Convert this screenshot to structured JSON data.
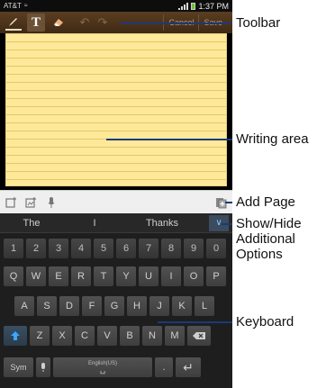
{
  "status_bar": {
    "carrier": "AT&T",
    "time": "1:37 PM",
    "battery_color": "#6cc12b"
  },
  "toolbar": {
    "pen_icon": "pen-icon",
    "text_label": "T",
    "eraser_icon": "eraser-icon",
    "undo_icon": "undo-icon",
    "redo_icon": "redo-icon",
    "cancel_label": "Cancel",
    "save_label": "Save"
  },
  "writing_area": {
    "paper_color": "#fde999",
    "rule_color": "#e7c766"
  },
  "page_bar": {
    "icons": [
      "insert-image-icon",
      "insert-media-icon",
      "microphone-icon"
    ],
    "add_page_icon": "add-page-icon"
  },
  "suggestions": {
    "items": [
      "The",
      "I",
      "Thanks"
    ],
    "toggle_icon": "chevron-down-icon"
  },
  "keyboard": {
    "rows": [
      [
        "1",
        "2",
        "3",
        "4",
        "5",
        "6",
        "7",
        "8",
        "9",
        "0"
      ],
      [
        "Q",
        "W",
        "E",
        "R",
        "T",
        "Y",
        "U",
        "I",
        "O",
        "P"
      ],
      [
        "A",
        "S",
        "D",
        "F",
        "G",
        "H",
        "J",
        "K",
        "L"
      ],
      [
        "Z",
        "X",
        "C",
        "V",
        "B",
        "N",
        "M"
      ]
    ],
    "sym_label": "Sym",
    "space_label": "English(US)",
    "shift_icon": "shift-arrow-icon",
    "backspace_icon": "backspace-icon",
    "enter_icon": "enter-icon",
    "dot_label": ".",
    "accent_color": "#3ba6ff"
  },
  "callouts": {
    "toolbar": "Toolbar",
    "writing_area": "Writing area",
    "add_page": "Add Page",
    "show_hide_1": "Show/Hide",
    "show_hide_2": "Additional",
    "show_hide_3": "Options",
    "keyboard": "Keyboard",
    "line_color": "#1a3a78"
  }
}
